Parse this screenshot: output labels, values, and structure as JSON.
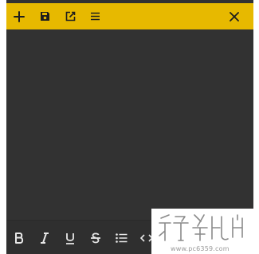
{
  "titlebar": {
    "background": "#e7b900",
    "icon_color": "#1e1e1e",
    "left_icons": [
      "plus-icon",
      "save-icon",
      "external-link-icon",
      "menu-icon"
    ],
    "right_icons": [
      "close-icon"
    ]
  },
  "editor": {
    "background": "#323232",
    "content": ""
  },
  "format_toolbar": {
    "icon_color": "#e8e8e8",
    "icons": [
      "bold-icon",
      "italic-icon",
      "underline-icon",
      "strikethrough-icon",
      "bullet-list-icon",
      "code-icon"
    ]
  },
  "watermark": {
    "url_text": "www.pc6359.com"
  }
}
